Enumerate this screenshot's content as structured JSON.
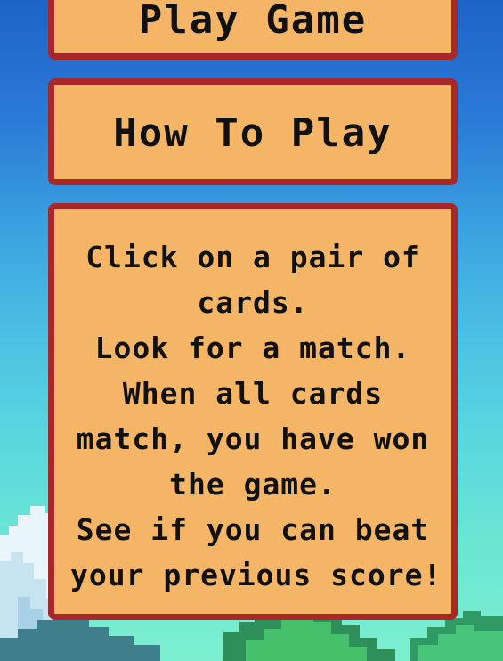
{
  "menu": {
    "play_button_label": "Play Game",
    "how_to_play_button_label": "How To Play"
  },
  "instructions": {
    "lines": [
      "Click on a pair of",
      "cards.",
      "Look for a match.",
      "When all cards",
      "match, you have won",
      "the game.",
      "See if you can beat",
      "your previous score!"
    ]
  },
  "colors": {
    "panel_fill": "#f4b566",
    "panel_border": "#a8282a",
    "text": "#111111",
    "sky_top": "#1f63c9",
    "sky_bottom": "#7cefcf",
    "mountain": "#3f7f8c",
    "grass": "#3fb56a"
  },
  "icons": {
    "cloud": "cloud-icon",
    "mountains": "mountain-icon"
  }
}
